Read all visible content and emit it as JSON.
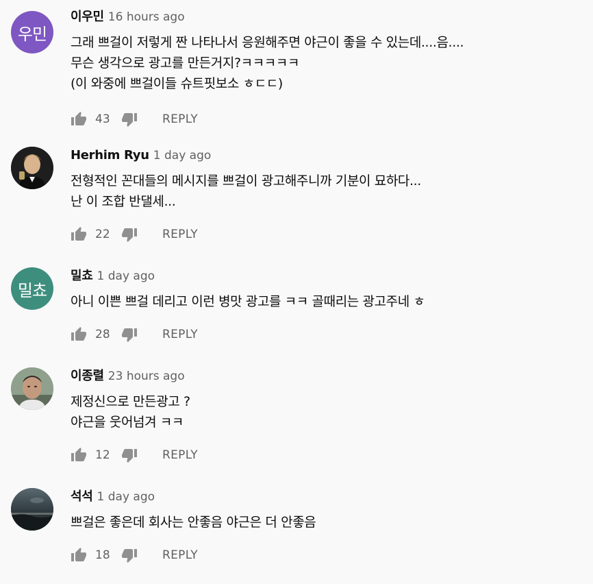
{
  "comments": [
    {
      "author": "이우민",
      "time": "16 hours ago",
      "avatar_text": "우민",
      "avatar_color": "#7e57c2",
      "lines": [
        "그래 쁘걸이 저렇게 짠 나타나서 응원해주면 야근이 좋을 수 있는데....음....",
        "무슨 생각으로 광고를 만든거지?ㅋㅋㅋㅋㅋ",
        "(이 와중에 쁘걸이들 슈트핏보소 ㅎㄷㄷ)"
      ],
      "likes": "43",
      "reply_label": "REPLY"
    },
    {
      "author": "Herhim Ryu",
      "time": "1 day ago",
      "avatar_text": "",
      "avatar_color": "#2b2b2b",
      "lines": [
        "전형적인 꼰대들의 메시지를 쁘걸이 광고해주니까 기분이 묘하다...",
        "난 이 조합 반댈세..."
      ],
      "likes": "22",
      "reply_label": "REPLY"
    },
    {
      "author": "밀쵸",
      "time": "1 day ago",
      "avatar_text": "밀쵸",
      "avatar_color": "#3e8e7e",
      "lines": [
        "아니 이쁜 쁘걸 데리고 이런 병맛 광고를 ㅋㅋ 골때리는 광고주네 ㅎ"
      ],
      "likes": "28",
      "reply_label": "REPLY"
    },
    {
      "author": "이종렬",
      "time": "23 hours ago",
      "avatar_text": "",
      "avatar_color": "#7a8a78",
      "lines": [
        "제정신으로 만든광고 ?",
        "야근을 웃어넘겨 ㅋㅋ"
      ],
      "likes": "12",
      "reply_label": "REPLY"
    },
    {
      "author": "석석",
      "time": "1 day ago",
      "avatar_text": "",
      "avatar_color": "#3a4448",
      "lines": [
        "쁘걸은 좋은데 회사는 안좋음 야근은 더 안좋음"
      ],
      "likes": "18",
      "reply_label": "REPLY"
    }
  ]
}
